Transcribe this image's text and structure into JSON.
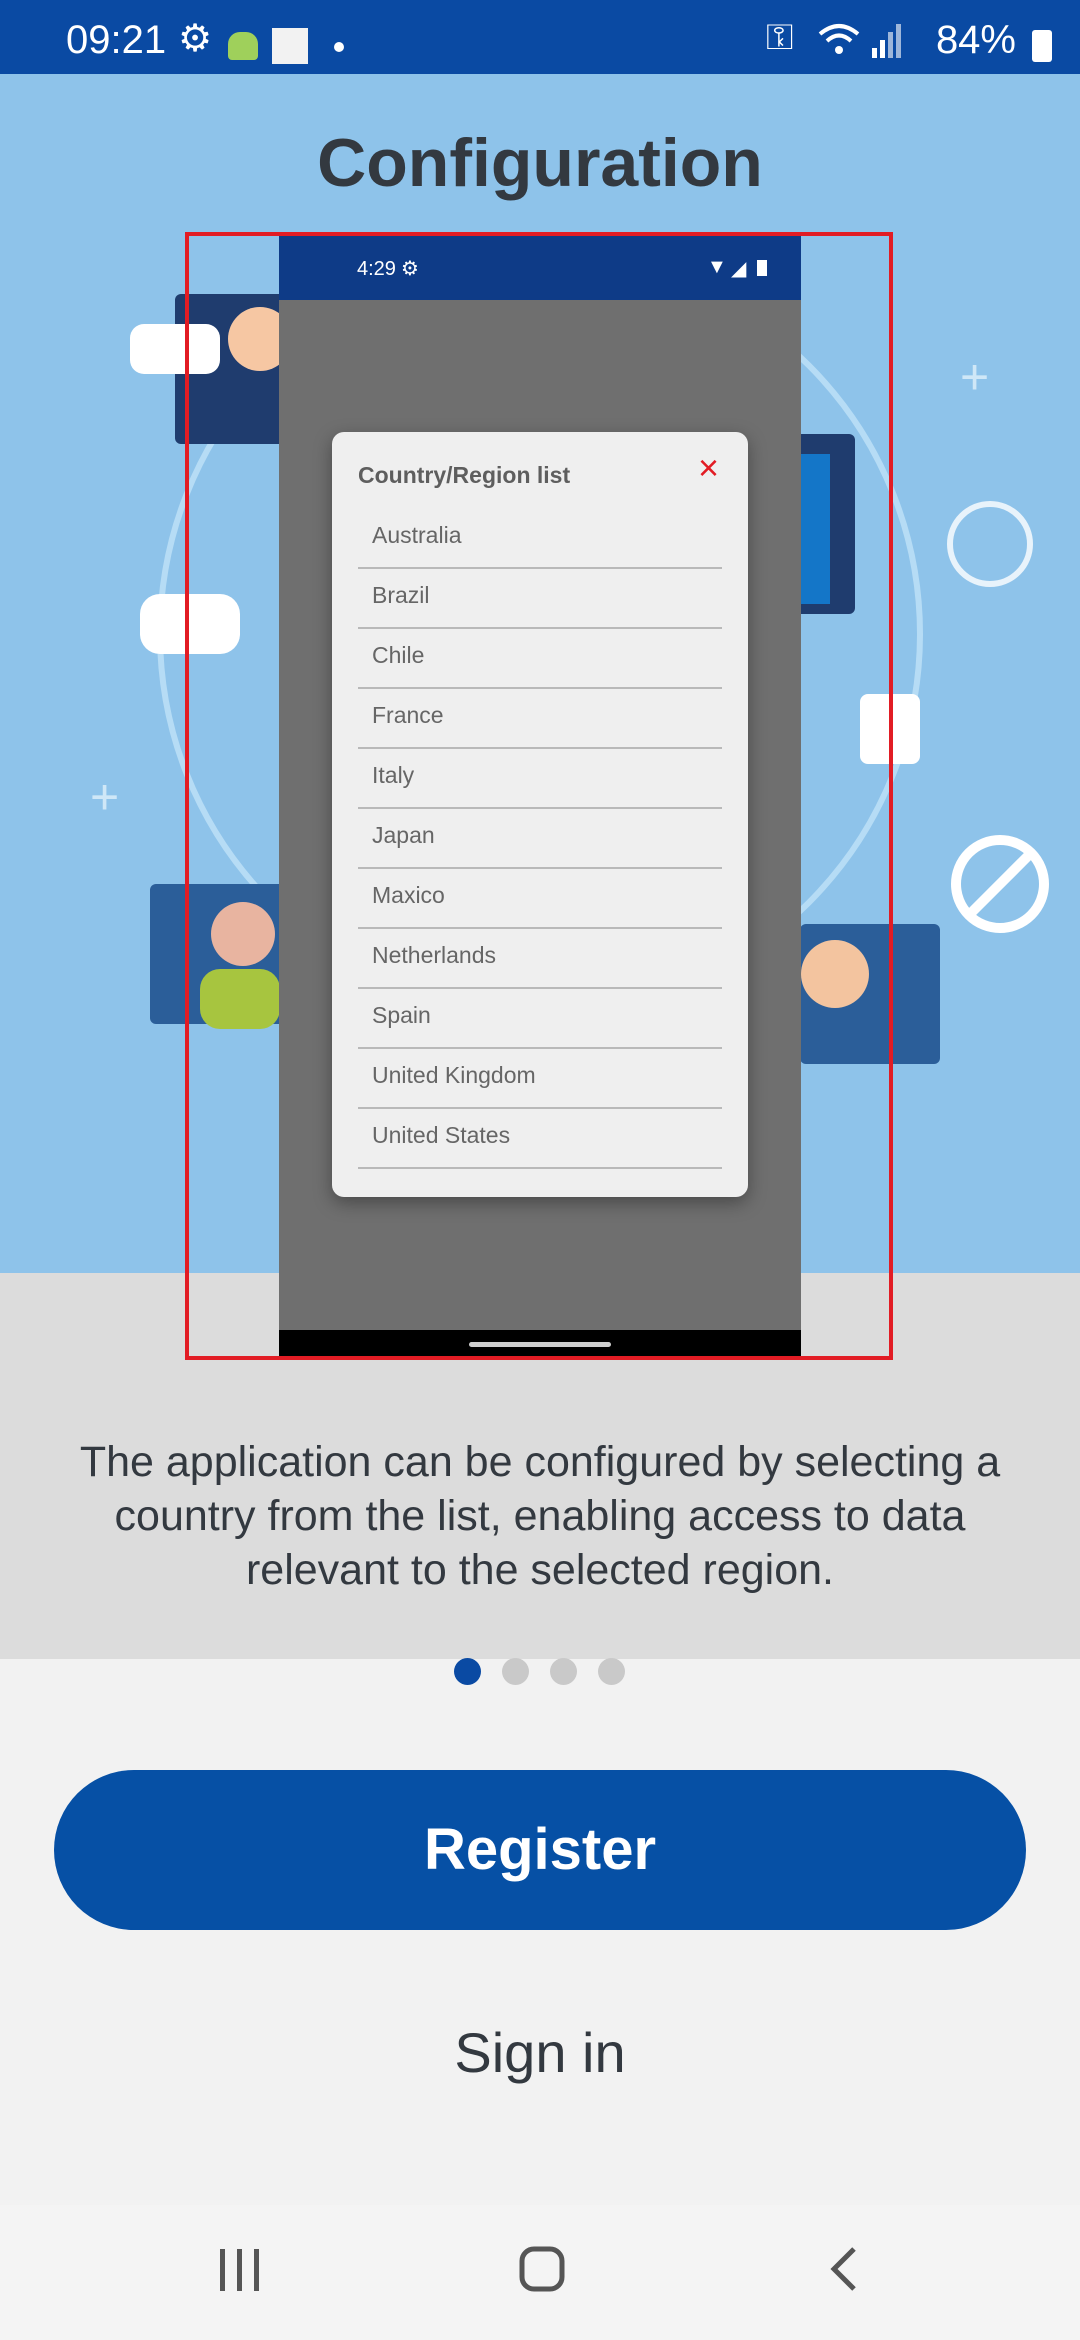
{
  "status_bar": {
    "time": "09:21",
    "battery": "84%"
  },
  "hero": {
    "title": "Configuration"
  },
  "mockup": {
    "time": "4:29",
    "dialog_title": "Country/Region list",
    "close_icon": "×",
    "countries": [
      "Australia",
      "Brazil",
      "Chile",
      "France",
      "Italy",
      "Japan",
      "Maxico",
      "Netherlands",
      "Spain",
      "United Kingdom",
      "United States"
    ]
  },
  "description": "The application can be configured by selecting a country from the list, enabling access to data relevant to the selected region.",
  "pager": {
    "pages": 4,
    "current": 1
  },
  "actions": {
    "register": "Register",
    "sign_in": "Sign in"
  },
  "nav": {
    "recents_icon": "recents-icon",
    "home_icon": "home-icon",
    "back_icon": "back-icon"
  },
  "colors": {
    "primary": "#0650a5",
    "statusbar": "#0a4aa3",
    "frame": "#e21c24"
  }
}
